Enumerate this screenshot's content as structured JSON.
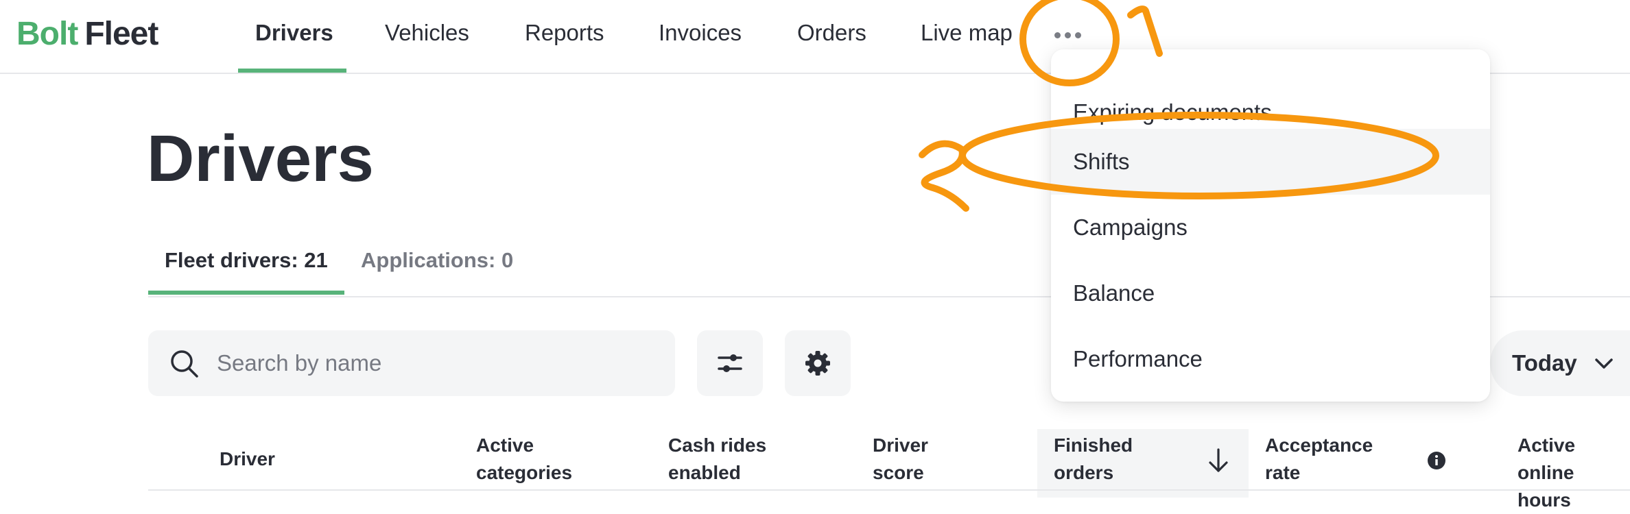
{
  "brand": {
    "logo_part1": "Bolt",
    "logo_part2": "Fleet",
    "accent_color": "#58b37a"
  },
  "nav": {
    "items": [
      "Drivers",
      "Vehicles",
      "Reports",
      "Invoices",
      "Orders",
      "Live map"
    ],
    "active": "Drivers",
    "more_icon": "more-horizontal-icon"
  },
  "page": {
    "title": "Drivers"
  },
  "tabs": [
    {
      "label": "Fleet drivers: 21",
      "active": true
    },
    {
      "label": "Applications: 0",
      "active": false
    }
  ],
  "search": {
    "placeholder": "Search by name",
    "icon": "search-icon"
  },
  "toolbar": {
    "filter_icon": "sliders-icon",
    "settings_icon": "gear-icon"
  },
  "period": {
    "selected": "Today",
    "icon": "chevron-down-icon"
  },
  "table": {
    "headers": [
      [
        "Driver"
      ],
      [
        "Active",
        "categories"
      ],
      [
        "Cash rides",
        "enabled"
      ],
      [
        "Driver",
        "score"
      ],
      [
        "Finished",
        "orders"
      ],
      [
        "Acceptance",
        "rate"
      ],
      [
        "Active online",
        "hours"
      ]
    ],
    "sorted_column": "Finished orders",
    "sort_icon": "arrow-down-icon",
    "info_icon": "info-icon"
  },
  "dropdown": {
    "items": [
      "Expiring documents",
      "Shifts",
      "Campaigns",
      "Balance",
      "Performance"
    ],
    "highlighted": "Shifts"
  },
  "annotations": {
    "color": "#f7970f",
    "marks": [
      "1",
      "2"
    ]
  }
}
